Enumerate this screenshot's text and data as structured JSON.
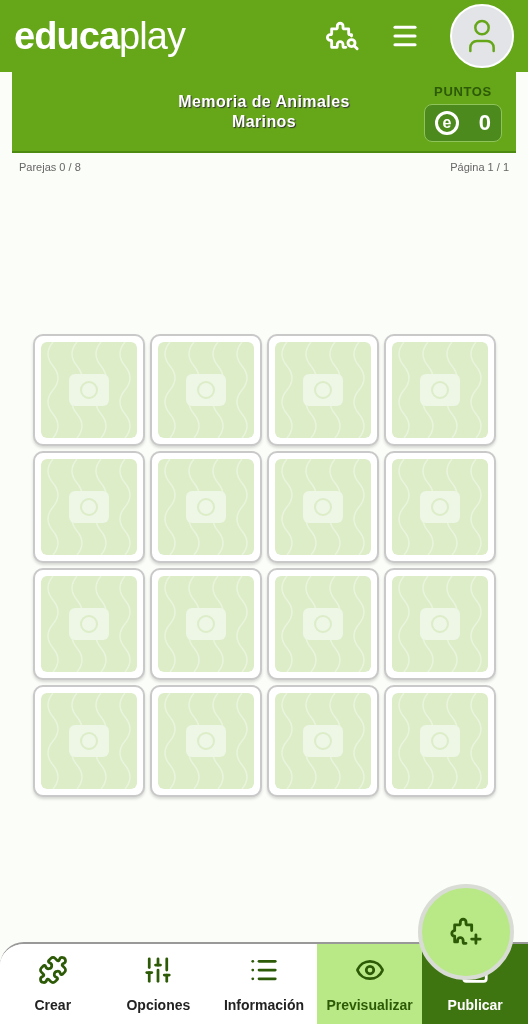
{
  "header": {
    "logo": {
      "left": "educa",
      "right": "play"
    }
  },
  "game": {
    "title": "Memoria de Animales Marinos",
    "points_label": "PUNTOS",
    "points": "0",
    "points_icon": "e",
    "pairs": "Parejas 0 / 8",
    "page": "Página 1 / 1"
  },
  "cards": [
    {
      "flipped": false
    },
    {
      "flipped": false
    },
    {
      "flipped": false
    },
    {
      "flipped": false
    },
    {
      "flipped": false
    },
    {
      "flipped": false
    },
    {
      "flipped": false
    },
    {
      "flipped": false
    },
    {
      "flipped": false
    },
    {
      "flipped": false
    },
    {
      "flipped": false
    },
    {
      "flipped": false
    },
    {
      "flipped": false
    },
    {
      "flipped": false
    },
    {
      "flipped": false
    },
    {
      "flipped": false
    }
  ],
  "bottom_nav": [
    {
      "kind": "tab",
      "label": "Crear",
      "selected": false
    },
    {
      "kind": "tab",
      "label": "Opciones",
      "selected": false
    },
    {
      "kind": "tab",
      "label": "Información",
      "selected": false
    },
    {
      "kind": "tab",
      "label": "Previsualizar",
      "selected": true
    },
    {
      "kind": "publish",
      "label": "Publicar"
    }
  ]
}
